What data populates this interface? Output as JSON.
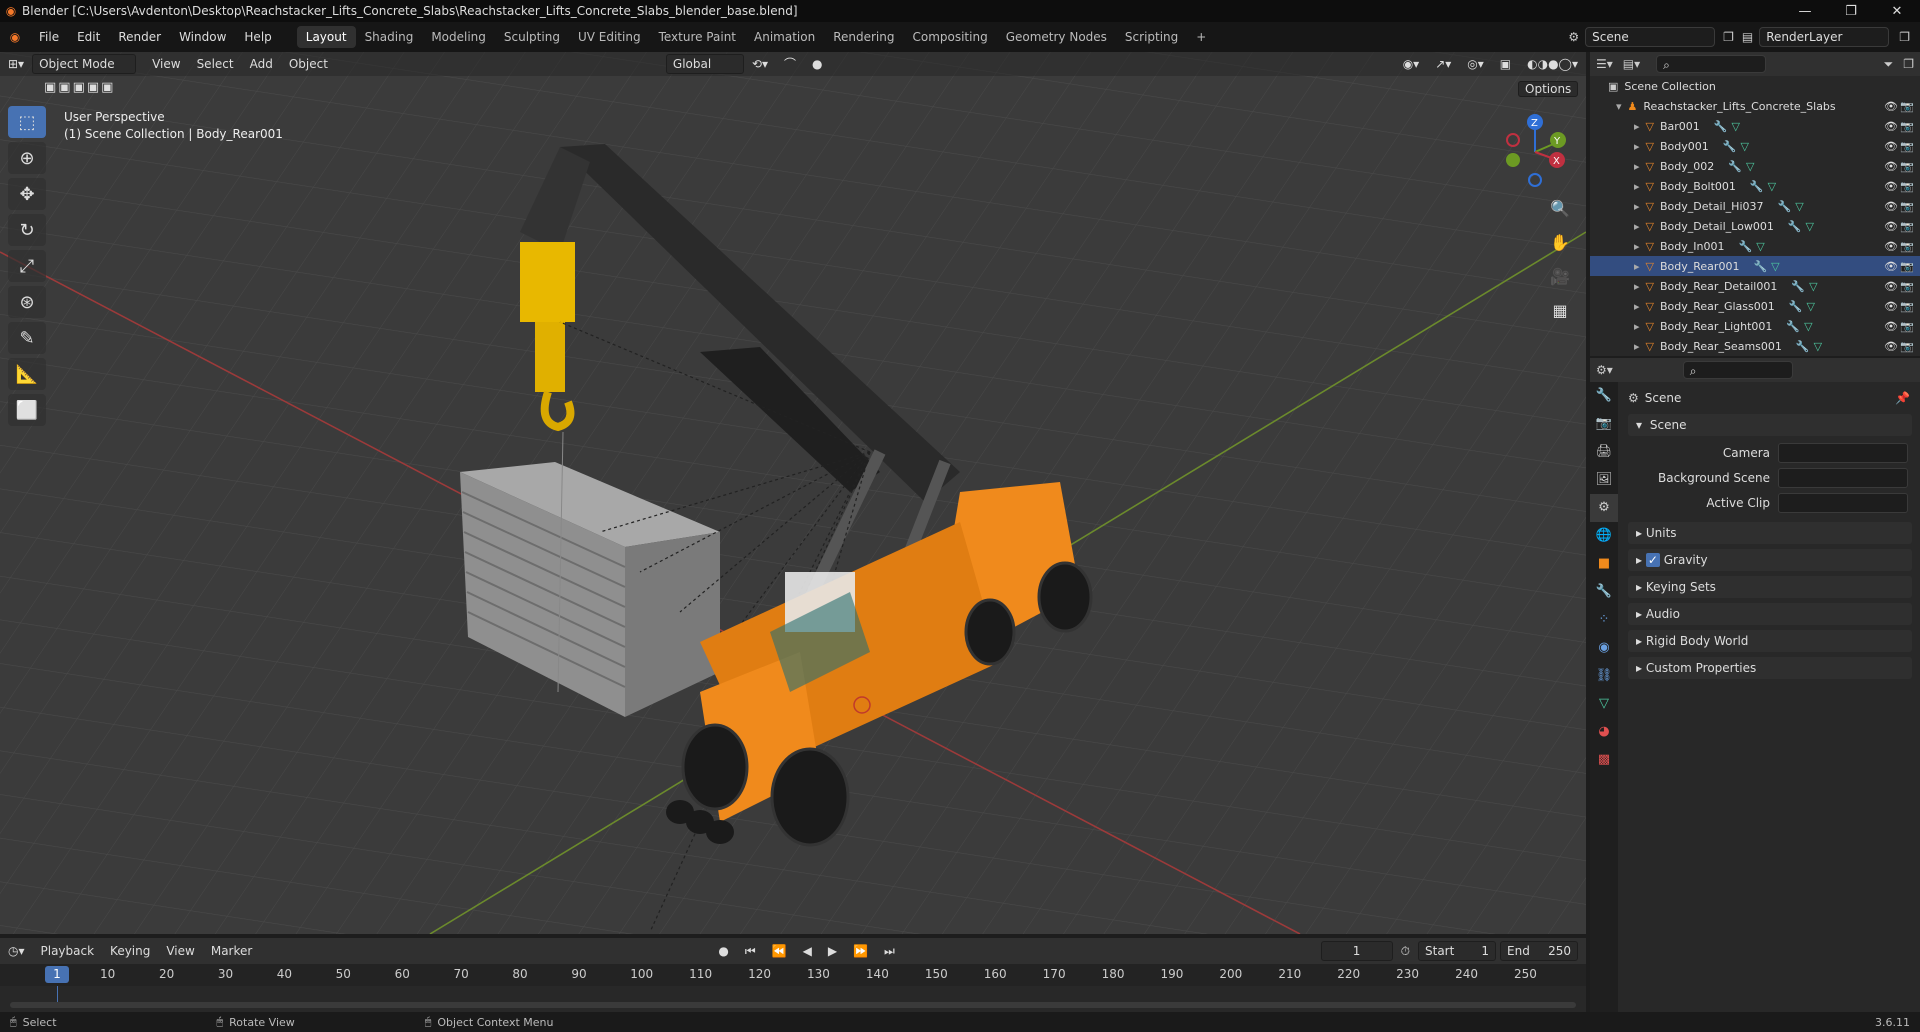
{
  "window": {
    "title": "Blender [C:\\Users\\Avdenton\\Desktop\\Reachstacker_Lifts_Concrete_Slabs\\Reachstacker_Lifts_Concrete_Slabs_blender_base.blend]",
    "minimize": "—",
    "maximize": "❐",
    "close": "✕"
  },
  "menus": [
    "File",
    "Edit",
    "Render",
    "Window",
    "Help"
  ],
  "workspaces": [
    "Layout",
    "Shading",
    "Modeling",
    "Sculpting",
    "UV Editing",
    "Texture Paint",
    "Animation",
    "Rendering",
    "Compositing",
    "Geometry Nodes",
    "Scripting",
    "+"
  ],
  "active_workspace": "Layout",
  "scene_field": "Scene",
  "render_layer": "RenderLayer",
  "viewport_header": {
    "mode": "Object Mode",
    "menus": [
      "View",
      "Select",
      "Add",
      "Object"
    ],
    "transform": "Global",
    "options": "Options"
  },
  "viewport_overlay": {
    "line1": "User Perspective",
    "line2": "(1) Scene Collection | Body_Rear001"
  },
  "gizmo": {
    "x": "X",
    "y": "Y",
    "z": "Z"
  },
  "outliner": {
    "root": "Scene Collection",
    "collection": "Reachstacker_Lifts_Concrete_Slabs",
    "items": [
      "Bar001",
      "Body001",
      "Body_002",
      "Body_Bolt001",
      "Body_Detail_Hi037",
      "Body_Detail_Low001",
      "Body_In001",
      "Body_Rear001",
      "Body_Rear_Detail001",
      "Body_Rear_Glass001",
      "Body_Rear_Light001",
      "Body_Rear_Seams001"
    ],
    "selected": "Body_Rear001"
  },
  "properties": {
    "context": "Scene",
    "panel": "Scene",
    "fields": [
      "Camera",
      "Background Scene",
      "Active Clip"
    ],
    "sections": [
      "Units",
      "Gravity",
      "Keying Sets",
      "Audio",
      "Rigid Body World",
      "Custom Properties"
    ],
    "gravity_checked": true
  },
  "timeline": {
    "menus": [
      "Playback",
      "Keying",
      "View",
      "Marker"
    ],
    "current_frame": "1",
    "start_label": "Start",
    "start": "1",
    "end_label": "End",
    "end": "250",
    "ticks": [
      "1",
      "10",
      "20",
      "30",
      "40",
      "50",
      "60",
      "70",
      "80",
      "90",
      "100",
      "110",
      "120",
      "130",
      "140",
      "150",
      "160",
      "170",
      "180",
      "190",
      "200",
      "210",
      "220",
      "230",
      "240",
      "250"
    ]
  },
  "status": {
    "select": "Select",
    "rotate": "Rotate View",
    "context": "Object Context Menu",
    "version": "3.6.11"
  },
  "colors": {
    "accent": "#4772b3",
    "orange": "#f08a1c",
    "selected_row": "#334d80"
  }
}
